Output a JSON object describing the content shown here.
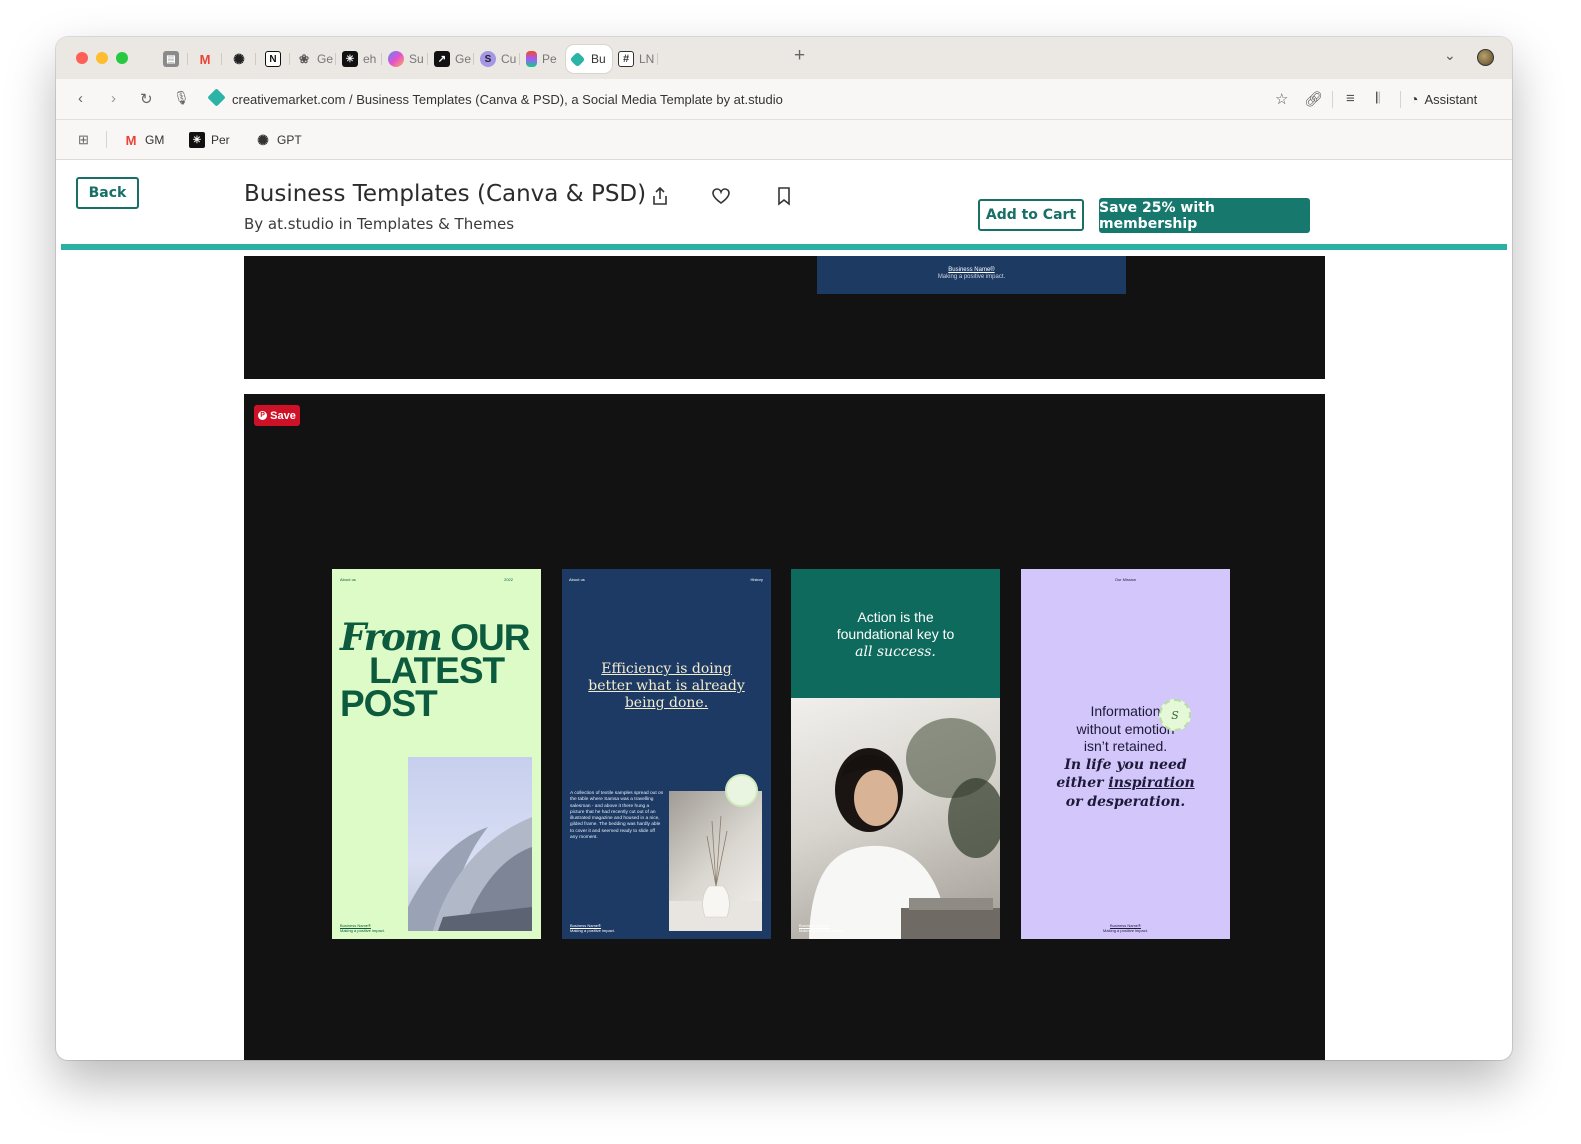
{
  "browser": {
    "tabs": [
      {
        "label": "",
        "icon": "archive-icon",
        "color": "#7a7a7a"
      },
      {
        "label": "",
        "icon": "gmail-icon",
        "color": "#ea4335"
      },
      {
        "label": "",
        "icon": "openai-icon",
        "color": "#222222"
      },
      {
        "label": "",
        "icon": "notion-icon",
        "color": "#111111"
      },
      {
        "label": "Ge",
        "icon": "gemini-icon",
        "color": "#555555"
      },
      {
        "label": "eh",
        "icon": "perplexity-icon",
        "color": "#111111"
      },
      {
        "label": "Su",
        "icon": "gradient-app-icon",
        "color": "#b455e8"
      },
      {
        "label": "Ge",
        "icon": "cursor-app-icon",
        "color": "#111111"
      },
      {
        "label": "Cu",
        "icon": "s-app-icon",
        "color": "#8d7ad9"
      },
      {
        "label": "Pe",
        "icon": "figma-icon",
        "color": "#f24e1e"
      },
      {
        "label": "Bu",
        "icon": "creativemarket-icon",
        "color": "#2ab3a6"
      },
      {
        "label": "LN",
        "icon": "table-icon",
        "color": "#333333"
      }
    ],
    "url": "creativemarket.com / Business Templates (Canva & PSD), a Social Media Template by at.studio",
    "assistant_label": "Assistant",
    "bookmarks": [
      {
        "label": "GM",
        "icon": "gmail-icon"
      },
      {
        "label": "Per",
        "icon": "perplexity-icon"
      },
      {
        "label": "GPT",
        "icon": "openai-icon"
      }
    ]
  },
  "header": {
    "back_label": "Back",
    "title": "Business Templates (Canva & PSD)",
    "byline": "By at.studio in Templates & Themes",
    "add_to_cart": "Add to Cart",
    "membership": "Save 25% with membership",
    "accent": "#2ab1a3"
  },
  "gallery": {
    "strip": {
      "business_name": "Business Name®",
      "tagline": "Making a positive impact."
    },
    "pin_save": "Save",
    "cards": [
      {
        "corner_left": "About us",
        "corner_right": "2022",
        "headline_serif": "From",
        "headline_1": "OUR",
        "headline_2": "LATEST",
        "headline_3": "POST",
        "business_name": "Business Name®",
        "tagline": "Making a positive impact."
      },
      {
        "corner_left": "About us",
        "corner_right": "History",
        "quote_1": "Efficiency is doing",
        "quote_2": "better what is already",
        "quote_3": "being done.",
        "body": "A collection of textile samples spread out on the table where Samsa was a travelling salesman - and above it there hung a picture that he had recently cut out of an illustrated magazine and housed in a nice, gilded frame. The bedding was hardly able to cover it and seemed ready to slide off any moment.",
        "business_name": "Business Name®",
        "tagline": "Making a positive impact."
      },
      {
        "quote_1": "Action is the",
        "quote_2": "foundational key to",
        "quote_3": "all success.",
        "business_name": "Business Name®",
        "tagline": "Making a positive impact."
      },
      {
        "corner_center": "Our Mission",
        "quote_1": "Information",
        "quote_2": "without emotion",
        "quote_3": "isn’t retained.",
        "quote_4": "In life you need",
        "quote_5a": "either ",
        "quote_5b": "inspiration",
        "quote_6": "or desperation.",
        "badge_letter": "S",
        "business_name": "Business Name®",
        "tagline": "Making a positive impact."
      }
    ]
  }
}
